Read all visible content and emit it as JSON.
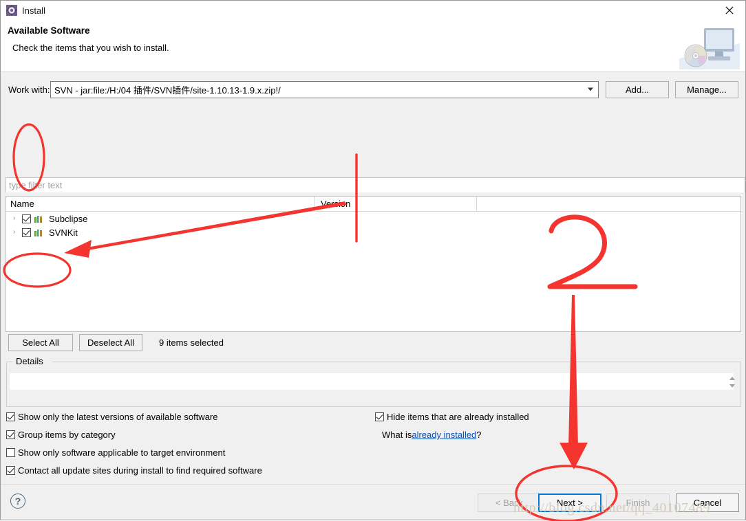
{
  "window": {
    "title": "Install",
    "title_icon": "gear-icon",
    "close_icon": "close-icon"
  },
  "header": {
    "title": "Available Software",
    "subtitle": "Check the items that you wish to install.",
    "banner_icon": "computer-disc-icon"
  },
  "workwith": {
    "label": "Work with:",
    "value": "SVN - jar:file:/H:/04 插件/SVN插件/site-1.10.13-1.9.x.zip!/",
    "dropdown_icon": "chevron-down-icon",
    "add_label": "Add...",
    "manage_label": "Manage..."
  },
  "filter": {
    "placeholder": "type filter text",
    "value": ""
  },
  "tree": {
    "columns": [
      "Name",
      "Version"
    ],
    "rows": [
      {
        "twisty": "›",
        "checked": true,
        "name": "Subclipse",
        "version": ""
      },
      {
        "twisty": "›",
        "checked": true,
        "name": "SVNKit",
        "version": ""
      }
    ]
  },
  "selection_bar": {
    "select_all_label": "Select All",
    "deselect_all_label": "Deselect All",
    "status": "9 items selected"
  },
  "details": {
    "legend": "Details",
    "content": "",
    "spinner_up_icon": "spinner-up-icon",
    "spinner_down_icon": "spinner-down-icon"
  },
  "options": {
    "left": [
      {
        "label": "Show only the latest versions of available software",
        "checked": true
      },
      {
        "label": "Group items by category",
        "checked": true
      },
      {
        "label": "Show only software applicable to target environment",
        "checked": false
      },
      {
        "label": "Contact all update sites during install to find required software",
        "checked": true
      }
    ],
    "right": [
      {
        "label": "Hide items that are already installed",
        "checked": true
      }
    ],
    "whatis_prefix": "What is ",
    "whatis_link": "already installed",
    "whatis_suffix": "?"
  },
  "footer": {
    "help_label": "?",
    "buttons": [
      {
        "label": "< Back",
        "enabled": false
      },
      {
        "label": "Next >",
        "enabled": true,
        "focused": true
      },
      {
        "label": "Finish",
        "enabled": false
      },
      {
        "label": "Cancel",
        "enabled": true
      }
    ]
  },
  "annotations": {
    "color": "#f4352f",
    "marks": [
      "ellipse-around-checkboxes",
      "arrow-to-select-all",
      "vertical-line-in-tree",
      "digit-2",
      "arrow-down-to-next",
      "ellipse-around-next-button",
      "ellipse-around-select-all"
    ],
    "digit_label": "2"
  },
  "watermark": {
    "text": "http://blog.csdn.net/qq_40107489"
  }
}
